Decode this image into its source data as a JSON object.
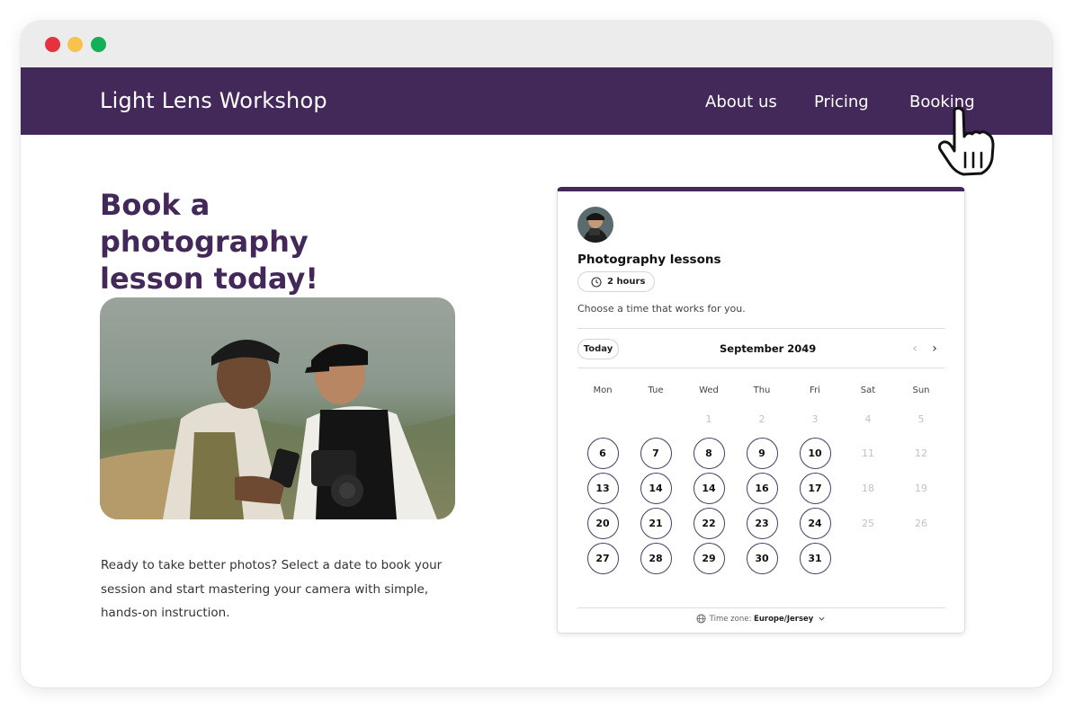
{
  "window": {
    "traffic_lights": [
      "#e5323f",
      "#f8c24d",
      "#12b057"
    ]
  },
  "navbar": {
    "brand": "Light Lens Workshop",
    "links": [
      "About us",
      "Pricing",
      "Booking"
    ],
    "background": "#43285a"
  },
  "cursor": {
    "icon": "pointer-hand-icon"
  },
  "hero": {
    "headline_line1": "Book a photography",
    "headline_line2": "lesson today!",
    "description": "Ready to take better photos? Select a date to book your session and start mastering your camera with simple, hands-on instruction."
  },
  "booking": {
    "event_title": "Photography lessons",
    "duration": "2 hours",
    "subtitle": "Choose a time that works for you.",
    "today_label": "Today",
    "month": "September 2049",
    "weekdays": [
      "Mon",
      "Tue",
      "Wed",
      "Thu",
      "Fri",
      "Sat",
      "Sun"
    ],
    "weeks": [
      [
        null,
        null,
        {
          "d": "1",
          "a": false
        },
        {
          "d": "2",
          "a": false
        },
        {
          "d": "3",
          "a": false
        },
        {
          "d": "4",
          "a": false
        },
        {
          "d": "5",
          "a": false
        }
      ],
      [
        {
          "d": "6",
          "a": true
        },
        {
          "d": "7",
          "a": true
        },
        {
          "d": "8",
          "a": true
        },
        {
          "d": "9",
          "a": true
        },
        {
          "d": "10",
          "a": true
        },
        {
          "d": "11",
          "a": false
        },
        {
          "d": "12",
          "a": false
        }
      ],
      [
        {
          "d": "13",
          "a": true
        },
        {
          "d": "14",
          "a": true
        },
        {
          "d": "14",
          "a": true
        },
        {
          "d": "16",
          "a": true
        },
        {
          "d": "17",
          "a": true
        },
        {
          "d": "18",
          "a": false
        },
        {
          "d": "19",
          "a": false
        }
      ],
      [
        {
          "d": "20",
          "a": true
        },
        {
          "d": "21",
          "a": true
        },
        {
          "d": "22",
          "a": true
        },
        {
          "d": "23",
          "a": true
        },
        {
          "d": "24",
          "a": true
        },
        {
          "d": "25",
          "a": false
        },
        {
          "d": "26",
          "a": false
        }
      ],
      [
        {
          "d": "27",
          "a": true
        },
        {
          "d": "28",
          "a": true
        },
        {
          "d": "29",
          "a": true
        },
        {
          "d": "30",
          "a": true
        },
        {
          "d": "31",
          "a": true
        },
        null,
        null
      ]
    ],
    "timezone_label": "Time zone:",
    "timezone_value": "Europe/Jersey"
  }
}
